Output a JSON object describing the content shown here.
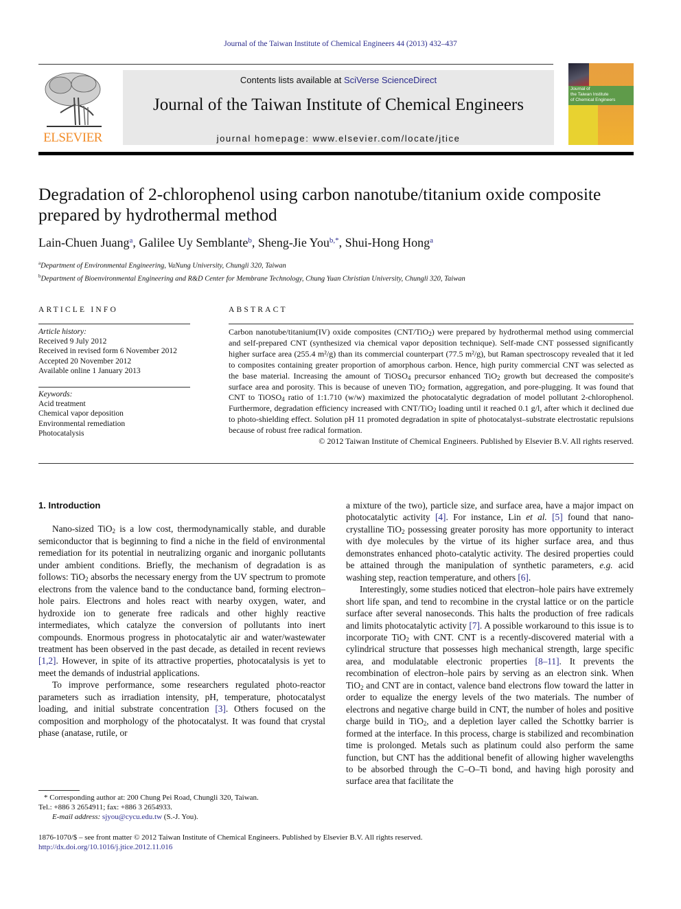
{
  "running_head": "Journal of the Taiwan Institute of Chemical Engineers 44 (2013) 432–437",
  "masthead": {
    "publisher_logo_text": "ELSEVIER",
    "contents_prefix": "Contents lists available at ",
    "contents_link": "SciVerse ScienceDirect",
    "journal_title": "Journal of the Taiwan Institute of Chemical Engineers",
    "homepage": "journal homepage: www.elsevier.com/locate/jtice",
    "cover_title_lines": [
      "Journal of",
      "the Taiwan Institute",
      "of Chemical Engineers"
    ]
  },
  "article": {
    "title": "Degradation of 2-chlorophenol using carbon nanotube/titanium oxide composite prepared by hydrothermal method",
    "authors": [
      {
        "name": "Lain-Chuen Juang",
        "sup": "a"
      },
      {
        "name": "Galilee Uy Semblante",
        "sup": "b"
      },
      {
        "name": "Sheng-Jie You",
        "sup": "b,*"
      },
      {
        "name": "Shui-Hong Hong",
        "sup": "a"
      }
    ],
    "affiliations": [
      {
        "mark": "a",
        "text": "Department of Environmental Engineering, VaNung University, Chungli 320, Taiwan"
      },
      {
        "mark": "b",
        "text": "Department of Bioenvironmental Engineering and R&D Center for Membrane Technology, Chung Yuan Christian University, Chungli 320, Taiwan"
      }
    ]
  },
  "article_info": {
    "label": "ARTICLE INFO",
    "history_label": "Article history:",
    "history": [
      "Received 9 July 2012",
      "Received in revised form 6 November 2012",
      "Accepted 20 November 2012",
      "Available online 1 January 2013"
    ],
    "keywords_label": "Keywords:",
    "keywords": [
      "Acid treatment",
      "Chemical vapor deposition",
      "Environmental remediation",
      "Photocatalysis"
    ]
  },
  "abstract": {
    "label": "ABSTRACT",
    "parts": [
      "Carbon nanotube/titanium(IV) oxide composites (CNT/TiO",
      "2",
      ") were prepared by hydrothermal method using commercial and self-prepared CNT (synthesized via chemical vapor deposition technique). Self-made CNT possessed significantly higher surface area (255.4 m²/g) than its commercial counterpart (77.5 m²/g), but Raman spectroscopy revealed that it led to composites containing greater proportion of amorphous carbon. Hence, high purity commercial CNT was selected as the base material. Increasing the amount of TiOSO",
      "4",
      " precursor enhanced TiO",
      "2",
      " growth but decreased the composite's surface area and porosity. This is because of uneven TiO",
      "2",
      " formation, aggregation, and pore-plugging. It was found that CNT to TiOSO",
      "4",
      " ratio of 1:1.710 (w/w) maximized the photocatalytic degradation of model pollutant 2-chlorophenol. Furthermore, degradation efficiency increased with CNT/TiO",
      "2",
      " loading until it reached 0.1 g/l, after which it declined due to photo-shielding effect. Solution pH 11 promoted degradation in spite of photocatalyst–substrate electrostatic repulsions because of robust free radical formation."
    ],
    "copyright": "© 2012 Taiwan Institute of Chemical Engineers. Published by Elsevier B.V. All rights reserved."
  },
  "body": {
    "section_heading": "1.  Introduction",
    "left_p1": [
      "Nano-sized TiO",
      "2",
      " is a low cost, thermodynamically stable, and durable semiconductor that is beginning to find a niche in the field of environmental remediation for its potential in neutralizing organic and inorganic pollutants under ambient conditions. Briefly, the mechanism of degradation is as follows: TiO",
      "2",
      " absorbs the necessary energy from the UV spectrum to promote electrons from the valence band to the conductance band, forming electron–hole pairs. Electrons and holes react with nearby oxygen, water, and hydroxide ion to generate free radicals and other highly reactive intermediates, which catalyze the conversion of pollutants into inert compounds. Enormous progress in photocatalytic air and water/wastewater treatment has been observed in the past decade, as detailed in recent reviews ",
      "[1,2]",
      ". However, in spite of its attractive properties, photocatalysis is yet to meet the demands of industrial applications."
    ],
    "left_p2": [
      "To improve performance, some researchers regulated photo-reactor parameters such as irradiation intensity, pH, temperature, photocatalyst loading, and initial substrate concentration ",
      "[3]",
      ". Others focused on the composition and morphology of the photocatalyst. It was found that crystal phase (anatase, rutile, or"
    ],
    "right_p1": [
      "a mixture of the two), particle size, and surface area, have a major impact on photocatalytic activity ",
      "[4]",
      ". For instance, Lin ",
      "et al.",
      " ",
      "[5]",
      " found that nano-crystalline TiO",
      "2",
      " possessing greater porosity has more opportunity to interact with dye molecules by the virtue of its higher surface area, and thus demonstrates enhanced photo-catalytic activity. The desired properties could be attained through the manipulation of synthetic parameters, ",
      "e.g.",
      " acid washing step, reaction temperature, and others ",
      "[6]",
      "."
    ],
    "right_p2": [
      "Interestingly, some studies noticed that electron–hole pairs have extremely short life span, and tend to recombine in the crystal lattice or on the particle surface after several nanoseconds. This halts the production of free radicals and limits photocatalytic activity ",
      "[7]",
      ". A possible workaround to this issue is to incorporate TiO",
      "2",
      " with CNT. CNT is a recently-discovered material with a cylindrical structure that possesses high mechanical strength, large specific area, and modulatable electronic properties ",
      "[8–11]",
      ". It prevents the recombination of electron–hole pairs by serving as an electron sink. When TiO",
      "2",
      " and CNT are in contact, valence band electrons flow toward the latter in order to equalize the energy levels of the two materials. The number of electrons and negative charge build in CNT, the number of holes and positive charge build in TiO",
      "2",
      ", and a depletion layer called the Schottky barrier is formed at the interface. In this process, charge is stabilized and recombination time is prolonged. Metals such as platinum could also perform the same function, but CNT has the additional benefit of allowing higher wavelengths to be absorbed through the C–O–Ti bond, and having high porosity and surface area that facilitate the"
    ]
  },
  "footnote": {
    "star_line": "* Corresponding author at: 200 Chung Pei Road, Chungli 320, Taiwan.",
    "tel_line": "Tel.: +886 3 2654911; fax: +886 3 2654933.",
    "email_label": "E-mail address: ",
    "email": "sjyou@cycu.edu.tw",
    "email_suffix": " (S.-J. You)."
  },
  "bottom": {
    "issn_line": "1876-1070/$ – see front matter © 2012 Taiwan Institute of Chemical Engineers. Published by Elsevier B.V. All rights reserved.",
    "doi": "http://dx.doi.org/10.1016/j.jtice.2012.11.016"
  }
}
